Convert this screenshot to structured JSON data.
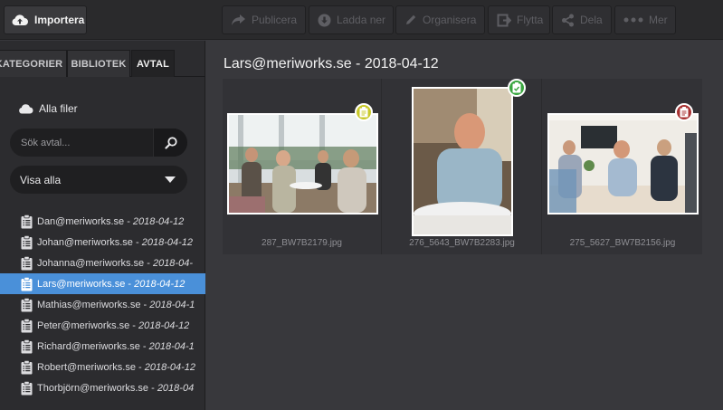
{
  "toolbar": {
    "import_label": "Importera",
    "publish_label": "Publicera",
    "download_label": "Ladda ner",
    "organize_label": "Organisera",
    "move_label": "Flytta",
    "share_label": "Dela",
    "more_label": "Mer"
  },
  "tabs": {
    "categories": "KATEGORIER",
    "library": "BIBLIOTEK",
    "agreements": "AVTAL"
  },
  "sidebar": {
    "all_files": "Alla filer",
    "search_placeholder": "Sök avtal...",
    "filter_value": "Visa alla",
    "agreements": [
      {
        "name": "Dan@meriworks.se",
        "date": "2018-04-12"
      },
      {
        "name": "Johan@meriworks.se",
        "date": "2018-04-12"
      },
      {
        "name": "Johanna@meriworks.se",
        "date": "2018-04-"
      },
      {
        "name": "Lars@meriworks.se",
        "date": "2018-04-12",
        "selected": true
      },
      {
        "name": "Mathias@meriworks.se",
        "date": "2018-04-1"
      },
      {
        "name": "Peter@meriworks.se",
        "date": "2018-04-12"
      },
      {
        "name": "Richard@meriworks.se",
        "date": "2018-04-1"
      },
      {
        "name": "Robert@meriworks.se",
        "date": "2018-04-12"
      },
      {
        "name": "Thorbjörn@meriworks.se",
        "date": "2018-04"
      }
    ]
  },
  "main": {
    "title": "Lars@meriworks.se - 2018-04-12",
    "photos": [
      {
        "filename": "287_BW7B2179.jpg",
        "badge_color": "#c9c92a",
        "badge_icon": "clipboard-icon"
      },
      {
        "filename": "276_5643_BW7B2283.jpg",
        "badge_color": "#3aa640",
        "badge_icon": "clipboard-check-icon"
      },
      {
        "filename": "275_5627_BW7B2156.jpg",
        "badge_color": "#a83232",
        "badge_icon": "clipboard-icon"
      }
    ]
  },
  "colors": {
    "accent_selected": "#4a90d9",
    "panel_bg": "#2c2c2f",
    "main_bg": "#38383c"
  }
}
